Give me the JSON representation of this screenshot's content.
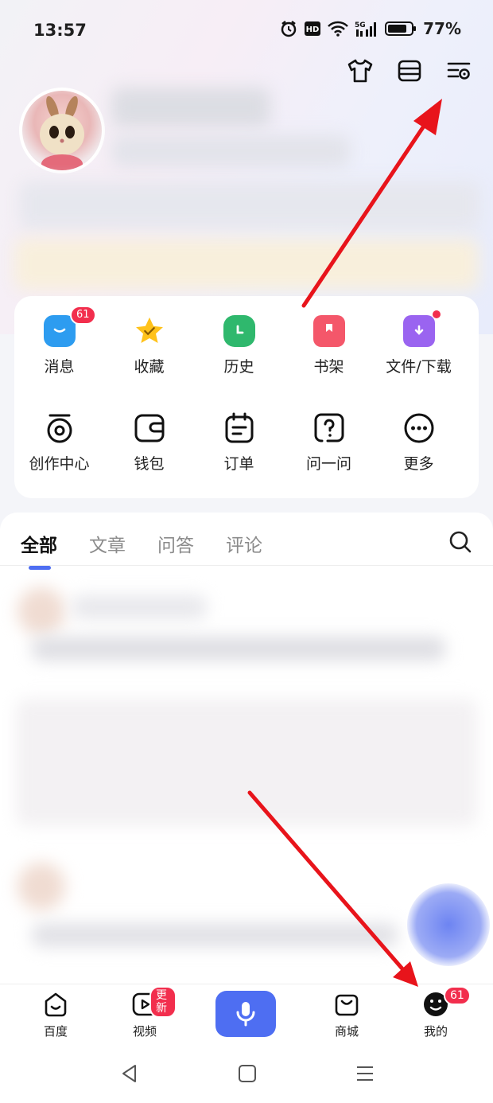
{
  "status_bar": {
    "time": "13:57",
    "battery": "77%",
    "network": "5G"
  },
  "top_actions": [
    {
      "icon": "shirt-icon"
    },
    {
      "icon": "scan-icon"
    },
    {
      "icon": "settings-icon"
    }
  ],
  "grid": {
    "row1": [
      {
        "label": "消息",
        "icon": "message-icon",
        "badge": "61"
      },
      {
        "label": "收藏",
        "icon": "star-icon"
      },
      {
        "label": "历史",
        "icon": "clock-icon"
      },
      {
        "label": "书架",
        "icon": "bookmark-icon"
      },
      {
        "label": "文件/下载",
        "icon": "download-folder-icon"
      }
    ],
    "row2": [
      {
        "label": "创作中心",
        "icon": "camera-icon"
      },
      {
        "label": "钱包",
        "icon": "wallet-icon"
      },
      {
        "label": "订单",
        "icon": "order-icon"
      },
      {
        "label": "问一问",
        "icon": "question-icon"
      },
      {
        "label": "更多",
        "icon": "more-icon"
      }
    ]
  },
  "tabs": [
    "全部",
    "文章",
    "问答",
    "评论"
  ],
  "bottom_nav": {
    "home": "百度",
    "video": "视频",
    "video_badge": "更新",
    "mall": "商城",
    "mine": "我的",
    "mine_badge": "61"
  },
  "colors": {
    "accent": "#4e6ef2",
    "badge": "#f22e4d",
    "arrow": "#e8141b"
  }
}
